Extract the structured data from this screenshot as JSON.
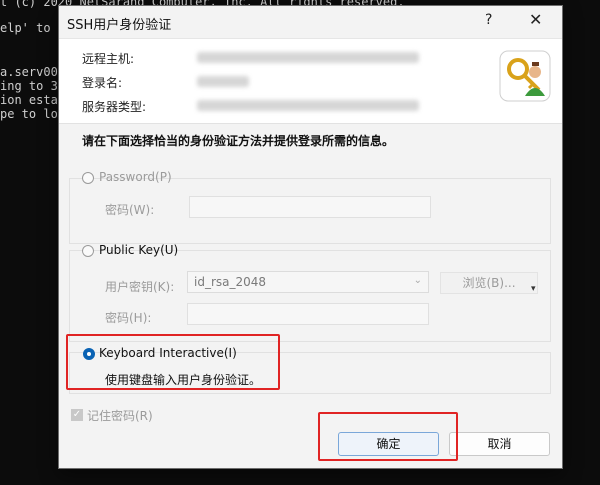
{
  "terminal": {
    "lines": [
      "t (c) 2020 NetSarang Computer, Inc. All rights reserved.",
      "elp' to le",
      "",
      "",
      "a.serv00.c",
      "ing to 31",
      "ion establ",
      "pe to loca"
    ]
  },
  "dialog": {
    "title": "SSH用户身份验证",
    "help_glyph": "?",
    "close_glyph": "✕",
    "info": {
      "remote_host_label": "远程主机:",
      "login_name_label": "登录名:",
      "server_type_label": "服务器类型:"
    },
    "prompt": "请在下面选择恰当的身份验证方法并提供登录所需的信息。",
    "password_option": {
      "label": "Password(P)",
      "password_field_label": "密码(W):"
    },
    "publickey_option": {
      "label": "Public Key(U)",
      "user_key_label": "用户密钥(K):",
      "user_key_value": "id_rsa_2048",
      "browse_button": "浏览(B)...",
      "password_label": "密码(H):"
    },
    "keyboard_option": {
      "label": "Keyboard Interactive(I)",
      "description": "使用键盘输入用户身份验证。",
      "selected": true
    },
    "remember_password": "记住密码(R)",
    "ok_button": "确定",
    "cancel_button": "取消"
  },
  "colors": {
    "accent": "#0a63b4",
    "highlight_box": "#e02424"
  },
  "icons": {
    "key_user": "key-user-icon",
    "browse_dropdown": "caret-down-icon"
  }
}
